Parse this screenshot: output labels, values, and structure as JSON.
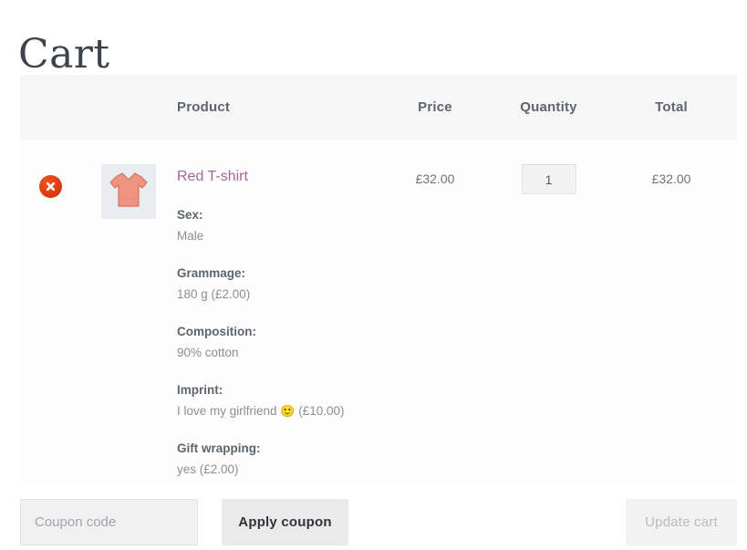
{
  "page": {
    "title": "Cart"
  },
  "cart": {
    "columns": {
      "remove": "",
      "thumbnail": "",
      "product": "Product",
      "price": "Price",
      "quantity": "Quantity",
      "total": "Total"
    },
    "items": [
      {
        "remove_icon": "remove-circle-x-icon",
        "thumbnail_icon": "tshirt-thumbnail",
        "name": "Red T-shirt",
        "price": "£32.00",
        "quantity": "1",
        "total": "£32.00",
        "variations": [
          {
            "label": "Sex:",
            "value": "Male"
          },
          {
            "label": "Grammage:",
            "value": "180 g (£2.00)"
          },
          {
            "label": "Composition:",
            "value": "90% cotton"
          },
          {
            "label": "Imprint:",
            "value_before": "I love my girlfriend",
            "emoji": "🙂",
            "value_after": "(£10.00)"
          },
          {
            "label": "Gift wrapping:",
            "value": "yes (£2.00)"
          }
        ]
      }
    ]
  },
  "actions": {
    "coupon_placeholder": "Coupon code",
    "coupon_value": "",
    "apply_label": "Apply coupon",
    "update_label": "Update cart"
  },
  "colors": {
    "accent_link": "#a4669a",
    "remove_red": "#dc3a12",
    "header_band": "#f6f6f6",
    "heading": "#3c434a",
    "label_text": "#5d6670",
    "value_text": "#8a8f95"
  }
}
